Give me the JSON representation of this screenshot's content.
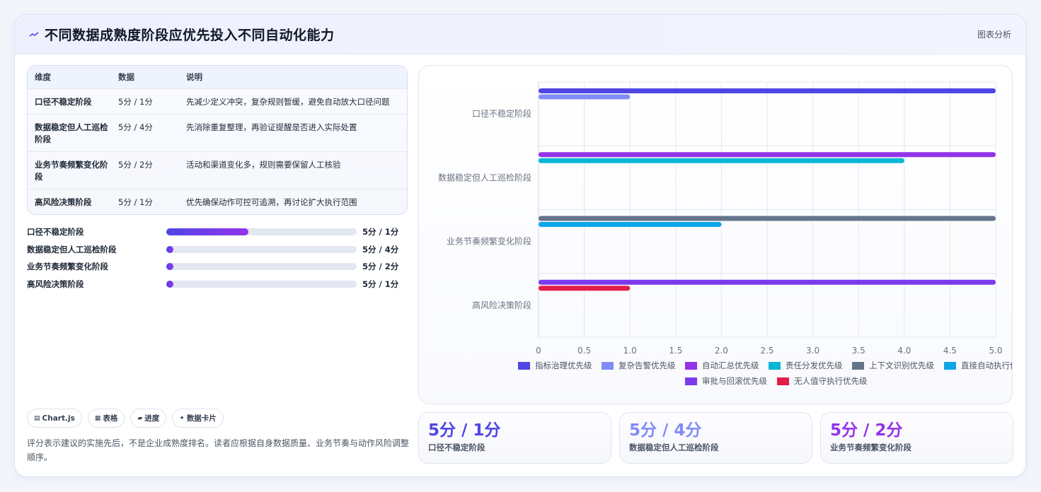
{
  "header": {
    "title": "不同数据成熟度阶段应优先投入不同自动化能力",
    "link": "图表分析"
  },
  "table": {
    "headers": [
      "维度",
      "数据",
      "说明"
    ],
    "rows": [
      [
        "口径不稳定阶段",
        "5分 / 1分",
        "先减少定义冲突，复杂规则暂缓，避免自动放大口径问题"
      ],
      [
        "数据稳定但人工巡检阶段",
        "5分 / 4分",
        "先消除重复整理，再验证提醒是否进入实际处置"
      ],
      [
        "业务节奏频繁变化阶段",
        "5分 / 2分",
        "活动和渠道变化多，规则需要保留人工核验"
      ],
      [
        "高风险决策阶段",
        "5分 / 1分",
        "优先确保动作可控可追溯，再讨论扩大执行范围"
      ]
    ]
  },
  "progress": [
    {
      "label": "口径不稳定阶段",
      "value": "5分 / 1分",
      "fill": 0.43
    },
    {
      "label": "数据稳定但人工巡检阶段",
      "value": "5分 / 4分",
      "fill": 0.0
    },
    {
      "label": "业务节奏频繁变化阶段",
      "value": "5分 / 2分",
      "fill": 0.0
    },
    {
      "label": "高风险决策阶段",
      "value": "5分 / 1分",
      "fill": 0.0
    }
  ],
  "chips": [
    {
      "icon": "chart-icon",
      "glyph": "▤",
      "label": "Chart.js"
    },
    {
      "icon": "table-icon",
      "glyph": "▦",
      "label": "表格"
    },
    {
      "icon": "progress-icon",
      "glyph": "▰",
      "label": "进度"
    },
    {
      "icon": "sparkle-icon",
      "glyph": "✦",
      "label": "数据卡片"
    }
  ],
  "note": "评分表示建议的实施先后，不是企业成熟度排名。读者应根据自身数据质量、业务节奏与动作风险调整顺序。",
  "kpis": [
    {
      "value": "5分 / 1分",
      "label": "口径不稳定阶段",
      "color": "#4f46e5"
    },
    {
      "value": "5分 / 4分",
      "label": "数据稳定但人工巡检阶段",
      "color": "#818cf8"
    },
    {
      "value": "5分 / 2分",
      "label": "业务节奏频繁变化阶段",
      "color": "#9333ea"
    }
  ],
  "chart_data": {
    "type": "bar",
    "orientation": "horizontal",
    "categories": [
      "口径不稳定阶段",
      "数据稳定但人工巡检阶段",
      "业务节奏频繁变化阶段",
      "高风险决策阶段"
    ],
    "xlim": [
      0,
      5
    ],
    "xticks": [
      "0",
      "0.5",
      "1.0",
      "1.5",
      "2.0",
      "2.5",
      "3.0",
      "3.5",
      "4.0",
      "4.5",
      "5.0"
    ],
    "grid": true,
    "legend_position": "bottom",
    "series": [
      {
        "name": "指标治理优先级",
        "color": "#4f46e5",
        "values": [
          5,
          null,
          null,
          null
        ]
      },
      {
        "name": "复杂告警优先级",
        "color": "#818cf8",
        "values": [
          1,
          null,
          null,
          null
        ]
      },
      {
        "name": "自动汇总优先级",
        "color": "#9333ea",
        "values": [
          null,
          5,
          null,
          null
        ]
      },
      {
        "name": "责任分发优先级",
        "color": "#06b6d4",
        "values": [
          null,
          4,
          null,
          null
        ]
      },
      {
        "name": "上下文识别优先级",
        "color": "#64748b",
        "values": [
          null,
          null,
          5,
          null
        ]
      },
      {
        "name": "直接自动执行优先级",
        "color": "#0ea5e9",
        "values": [
          null,
          null,
          2,
          null
        ]
      },
      {
        "name": "审批与回滚优先级",
        "color": "#7c3aed",
        "values": [
          null,
          null,
          null,
          5
        ]
      },
      {
        "name": "无人值守执行优先级",
        "color": "#e11d48",
        "values": [
          null,
          null,
          null,
          1
        ]
      }
    ]
  }
}
